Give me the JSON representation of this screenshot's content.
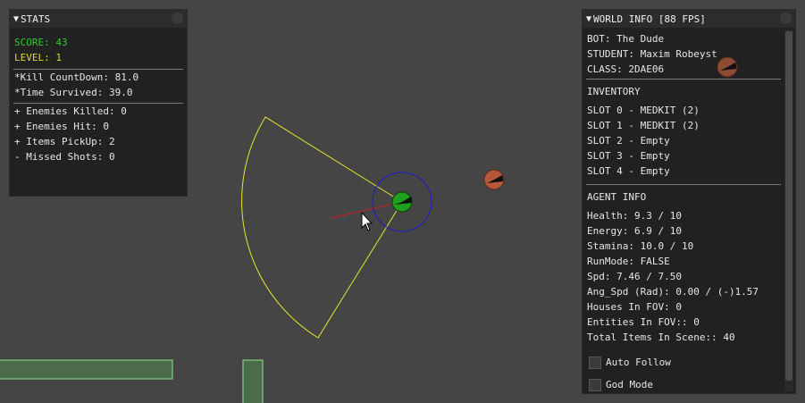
{
  "stats": {
    "title": "STATS",
    "score": "SCORE: 43",
    "level": "LEVEL: 1",
    "kill_countdown": "*Kill CountDown: 81.0",
    "time_survived": "*Time Survived: 39.0",
    "enemies_killed": "+ Enemies Killed: 0",
    "enemies_hit": "+ Enemies Hit: 0",
    "items_pickup": "+ Items PickUp: 2",
    "missed_shots": "- Missed Shots: 0"
  },
  "world": {
    "title": "WORLD INFO [88 FPS]",
    "bot": "BOT: The Dude",
    "student": "STUDENT: Maxim Robeyst",
    "class": "CLASS: 2DAE06",
    "inventory_header": "INVENTORY",
    "slots": [
      "SLOT 0 - MEDKIT (2)",
      "SLOT 1 - MEDKIT (2)",
      "SLOT 2 - Empty",
      "SLOT 3 - Empty",
      "SLOT 4 - Empty"
    ],
    "agent_header": "AGENT INFO",
    "health": "Health: 9.3 / 10",
    "energy": "Energy: 6.9 / 10",
    "stamina": "Stamina: 10.0 / 10",
    "runmode": "RunMode: FALSE",
    "spd": "Spd: 7.46 / 7.50",
    "ang_spd": "Ang_Spd (Rad): 0.00 / (-)1.57",
    "houses_fov": "Houses In FOV: 0",
    "entities_fov": "Entities In FOV:: 0",
    "total_items": "Total Items In Scene:: 40",
    "auto_follow": "Auto Follow",
    "god_mode": "God Mode"
  },
  "colors": {
    "background": "#454545",
    "fov_cone": "#e6e62e",
    "agent_ring": "#1c1ccc",
    "agent_body": "#1f9f1f",
    "enemy": "#b3593a",
    "aim_line": "#cc2020",
    "wall_fill": "#4b6b4b",
    "wall_stroke": "#8fe08f"
  }
}
